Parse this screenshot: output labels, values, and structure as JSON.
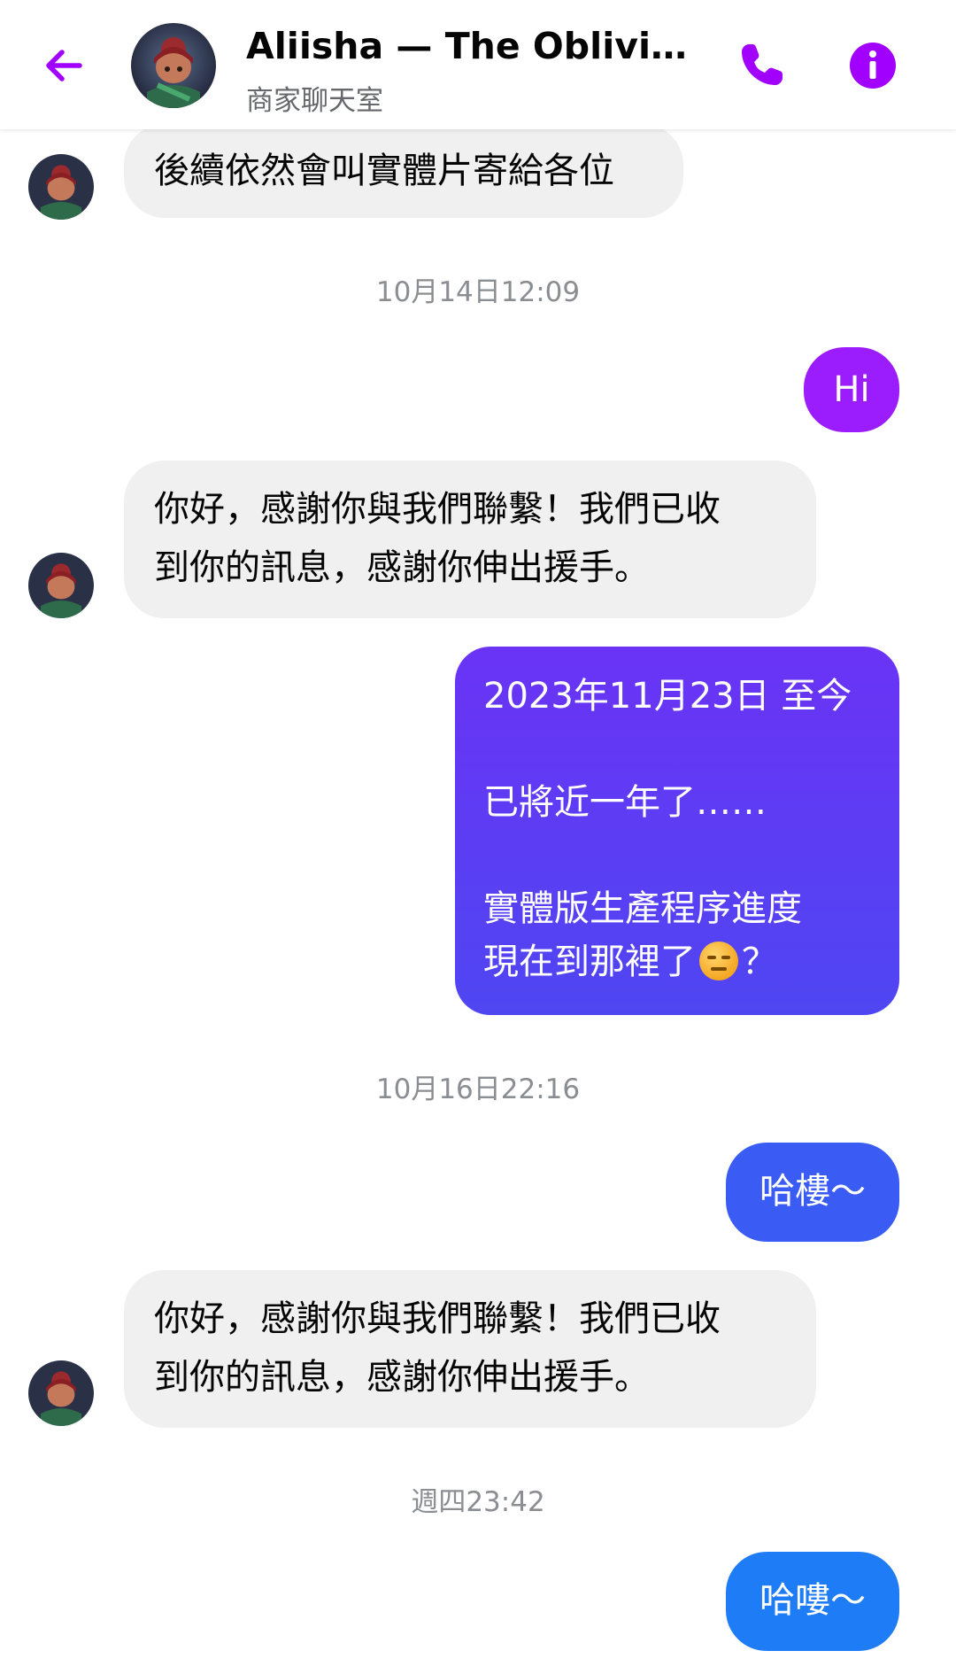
{
  "header": {
    "title": "Aliisha — The Oblivion…",
    "subtitle": "商家聊天室",
    "back_icon": "arrow-left-icon",
    "call_icon": "phone-icon",
    "info_icon": "info-icon",
    "accent_color": "#a100ff"
  },
  "messages": {
    "m1": "後續依然會叫實體片寄給各位",
    "ts1": "10月14日12:09",
    "m2": "Hi",
    "m3_line1": "你好，感謝你與我們聯繫！我們已收",
    "m3_line2": "到你的訊息，感謝你伸出援手。",
    "m4_line1": "2023年11月23日 至今",
    "m4_line2": "已將近一年了……",
    "m4_line3": "實體版生產程序進度",
    "m4_line4": "現在到那裡了",
    "m4_emoji": "expressionless-face-emoji",
    "m4_end": "？",
    "ts2": "10月16日22:16",
    "m5": "哈樓～",
    "m6_line1": "你好，感謝你與我們聯繫！我們已收",
    "m6_line2": "到你的訊息，感謝你伸出援手。",
    "ts3": "週四23:42",
    "m7": "哈嘍～"
  },
  "colors": {
    "incoming_bubble": "#f0f0f0",
    "outgoing_purple": "#9b1cfc",
    "outgoing_indigo": "#5b3df6",
    "outgoing_blue": "#2e5df5",
    "outgoing_lightblue": "#1f7cf7"
  }
}
